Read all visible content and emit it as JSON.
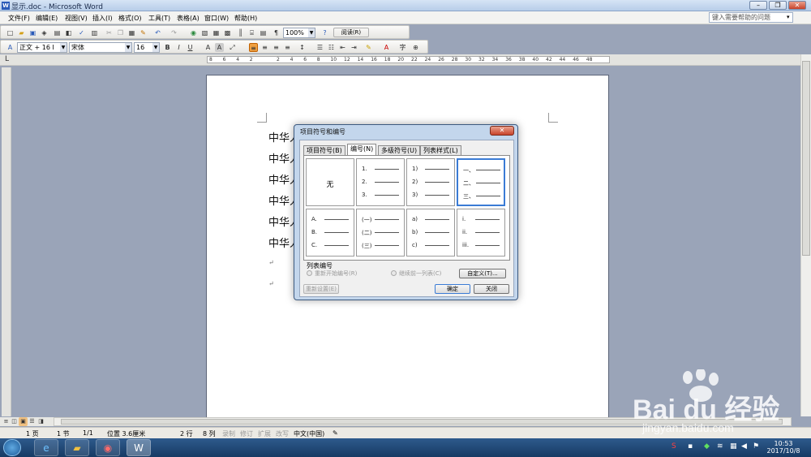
{
  "window": {
    "title": "显示.doc - Microsoft Word",
    "minimize": "–",
    "restore": "❐",
    "close": "✕"
  },
  "menu": [
    "文件(F)",
    "编辑(E)",
    "视图(V)",
    "插入(I)",
    "格式(O)",
    "工具(T)",
    "表格(A)",
    "窗口(W)",
    "帮助(H)"
  ],
  "ask_placeholder": "键入需要帮助的问题",
  "toolbar": {
    "zoom": "100%",
    "read_label": "阅读(R)"
  },
  "format": {
    "style": "正文 + 16 I",
    "font": "宋体",
    "size": "16",
    "bold": "B",
    "italic": "I",
    "underline": "U"
  },
  "ruler_ticks": [
    "8",
    "6",
    "4",
    "2",
    "",
    "2",
    "4",
    "6",
    "8",
    "10",
    "12",
    "14",
    "16",
    "18",
    "20",
    "22",
    "24",
    "26",
    "28",
    "30",
    "32",
    "34",
    "36",
    "38",
    "40",
    "42",
    "44",
    "46",
    "48"
  ],
  "document": {
    "lines": [
      "中华人",
      "中华人",
      "中华人",
      "中华人",
      "中华人",
      "中华人"
    ],
    "para_marks": [
      "↵",
      "↵"
    ]
  },
  "dialog": {
    "title": "项目符号和编号",
    "tabs": [
      "项目符号(B)",
      "编号(N)",
      "多级符号(U)",
      "列表样式(L)"
    ],
    "active_tab": 1,
    "none_label": "无",
    "styles": [
      {
        "labels": []
      },
      {
        "labels": [
          "1.",
          "2.",
          "3."
        ]
      },
      {
        "labels": [
          "1)",
          "2)",
          "3)"
        ]
      },
      {
        "labels": [
          "一、",
          "二、",
          "三、"
        ]
      },
      {
        "labels": [
          "A.",
          "B.",
          "C."
        ]
      },
      {
        "labels": [
          "(一)",
          "(二)",
          "(三)"
        ]
      },
      {
        "labels": [
          "a)",
          "b)",
          "c)"
        ]
      },
      {
        "labels": [
          "i.",
          "ii.",
          "iii."
        ]
      }
    ],
    "selected_index": 3,
    "list_numbering_label": "列表编号",
    "restart_label": "重新开始编号(R)",
    "continue_label": "继续前一列表(C)",
    "customize_label": "自定义(T)...",
    "reset_label": "重新设置(E)",
    "ok_label": "确定",
    "close_label": "关闭"
  },
  "status": {
    "page": "1 页",
    "section": "1 节",
    "pages": "1/1",
    "position": "位置 3.6厘米",
    "line": "2 行",
    "col": "8 列",
    "rec": "录制",
    "trk": "修订",
    "ext": "扩展",
    "ovr": "改写",
    "lang": "中文(中国)"
  },
  "taskbar": {
    "time": "10:53",
    "date": "2017/10/8"
  },
  "watermark": {
    "brand": "Bai du 经验",
    "url": "jingyan.baidu.com"
  }
}
